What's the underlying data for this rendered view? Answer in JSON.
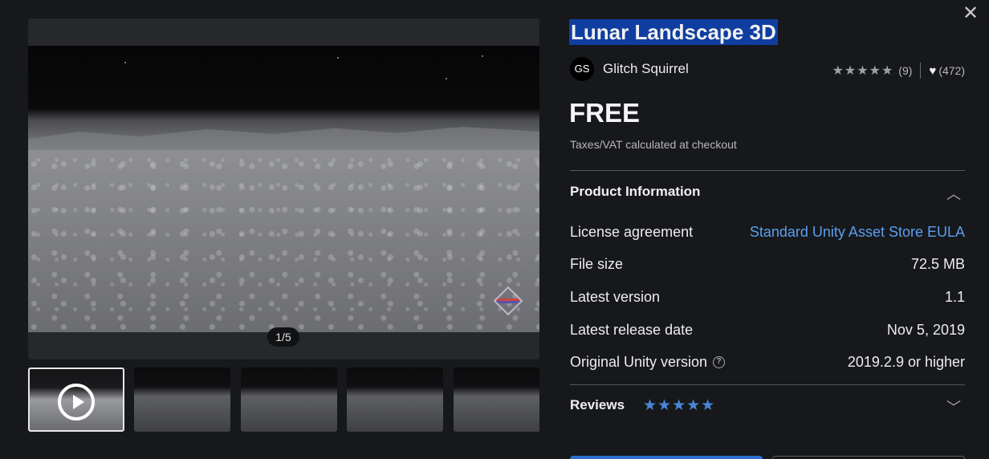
{
  "viewer": {
    "pager": "1/5"
  },
  "thumbnails": [
    {
      "kind": "video",
      "selected": true
    },
    {
      "kind": "image",
      "selected": false
    },
    {
      "kind": "image",
      "selected": false
    },
    {
      "kind": "image",
      "selected": false
    },
    {
      "kind": "image",
      "selected": false
    }
  ],
  "product": {
    "title": "Lunar Landscape 3D",
    "publisher_initials": "GS",
    "publisher": "Glitch Squirrel",
    "rating_stars": "★★★★★",
    "rating_count": "(9)",
    "favorites": "(472)",
    "price": "FREE",
    "tax_note": "Taxes/VAT calculated at checkout"
  },
  "product_info": {
    "heading": "Product Information",
    "rows": [
      {
        "label": "License agreement",
        "value": "Standard Unity Asset Store EULA"
      },
      {
        "label": "File size",
        "value": "72.5 MB"
      },
      {
        "label": "Latest version",
        "value": "1.1"
      },
      {
        "label": "Latest release date",
        "value": "Nov 5, 2019"
      },
      {
        "label": "Original Unity version",
        "value": "2019.2.9 or higher"
      }
    ]
  },
  "reviews": {
    "heading": "Reviews",
    "stars": "★★★★★"
  },
  "icons": {
    "close": "close-icon",
    "heart": "heart-icon",
    "help": "question-circle-icon",
    "chevron_up": "chevron-up-icon",
    "chevron_down": "chevron-down-icon",
    "play": "play-icon"
  },
  "colors": {
    "background": "#17181b",
    "link": "#5a9ff0",
    "title_highlight": "#0f3ea0",
    "review_stars": "#4a86d8"
  }
}
